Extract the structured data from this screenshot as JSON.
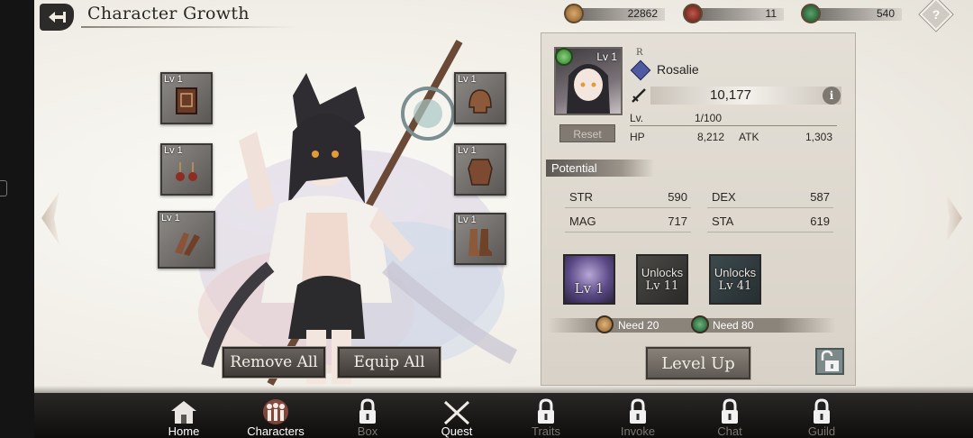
{
  "header": {
    "title": "Character Growth",
    "resources": [
      {
        "icon": "gold-coin-icon",
        "value": "22862"
      },
      {
        "icon": "red-gem-icon",
        "value": "11"
      },
      {
        "icon": "green-orb-icon",
        "value": "540"
      }
    ]
  },
  "equipment": {
    "left": [
      {
        "level": "Lv 1",
        "item": "book-icon"
      },
      {
        "level": "Lv 1",
        "item": "earrings-icon"
      },
      {
        "level": "Lv 1",
        "item": "gloves-icon"
      }
    ],
    "right": [
      {
        "level": "Lv 1",
        "item": "helmet-icon"
      },
      {
        "level": "Lv 1",
        "item": "armor-icon"
      },
      {
        "level": "Lv 1",
        "item": "boots-icon"
      }
    ],
    "remove_all": "Remove All",
    "equip_all": "Equip All"
  },
  "character": {
    "portrait_level": "Lv 1",
    "rarity": "R",
    "name": "Rosalie",
    "power": "10,177",
    "info_glyph": "i",
    "reset": "Reset",
    "level_label": "Lv.",
    "level_value": "1/100",
    "hp_label": "HP",
    "hp_value": "8,212",
    "atk_label": "ATK",
    "atk_value": "1,303"
  },
  "potential": {
    "title": "Potential",
    "stats": [
      {
        "label": "STR",
        "value": "590"
      },
      {
        "label": "DEX",
        "value": "587"
      },
      {
        "label": "MAG",
        "value": "717"
      },
      {
        "label": "STA",
        "value": "619"
      }
    ]
  },
  "skills": [
    {
      "line1": "",
      "line2": "Lv 1"
    },
    {
      "line1": "Unlocks",
      "line2": "Lv 11"
    },
    {
      "line1": "Unlocks",
      "line2": "Lv 41"
    }
  ],
  "level_up": {
    "need_gold": "Need 20",
    "need_orb": "Need 80",
    "button": "Level Up"
  },
  "nav": [
    {
      "label": "Home",
      "icon": "home-icon",
      "locked": false
    },
    {
      "label": "Characters",
      "icon": "characters-icon",
      "locked": false
    },
    {
      "label": "Box",
      "icon": "lock-icon",
      "locked": true
    },
    {
      "label": "Quest",
      "icon": "crossed-swords-icon",
      "locked": false
    },
    {
      "label": "Traits",
      "icon": "lock-icon",
      "locked": true
    },
    {
      "label": "Invoke",
      "icon": "lock-icon",
      "locked": true
    },
    {
      "label": "Chat",
      "icon": "lock-icon",
      "locked": true
    },
    {
      "label": "Guild",
      "icon": "lock-icon",
      "locked": true
    }
  ],
  "colors": {
    "panel_bg": "#e4dfd6",
    "nav_bg": "#1c1b1a",
    "element_leaf": "#3d8a3a"
  }
}
